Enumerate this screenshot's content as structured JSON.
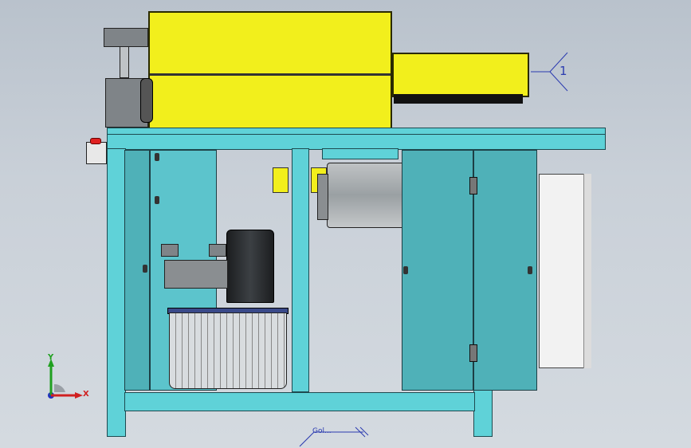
{
  "annotation": {
    "balloon_label": "1"
  },
  "triad": {
    "x_label": "X",
    "y_label": "Y"
  },
  "bottom_note": {
    "text": "Gol..."
  },
  "colors": {
    "frame": "#5fd2d8",
    "panel": "#4fb1b8",
    "hood": "#f2ef1c",
    "annotation": "#2b3bb0"
  },
  "icons": {
    "triad": "coordinate-triad-icon",
    "balloon": "callout-balloon-icon"
  }
}
